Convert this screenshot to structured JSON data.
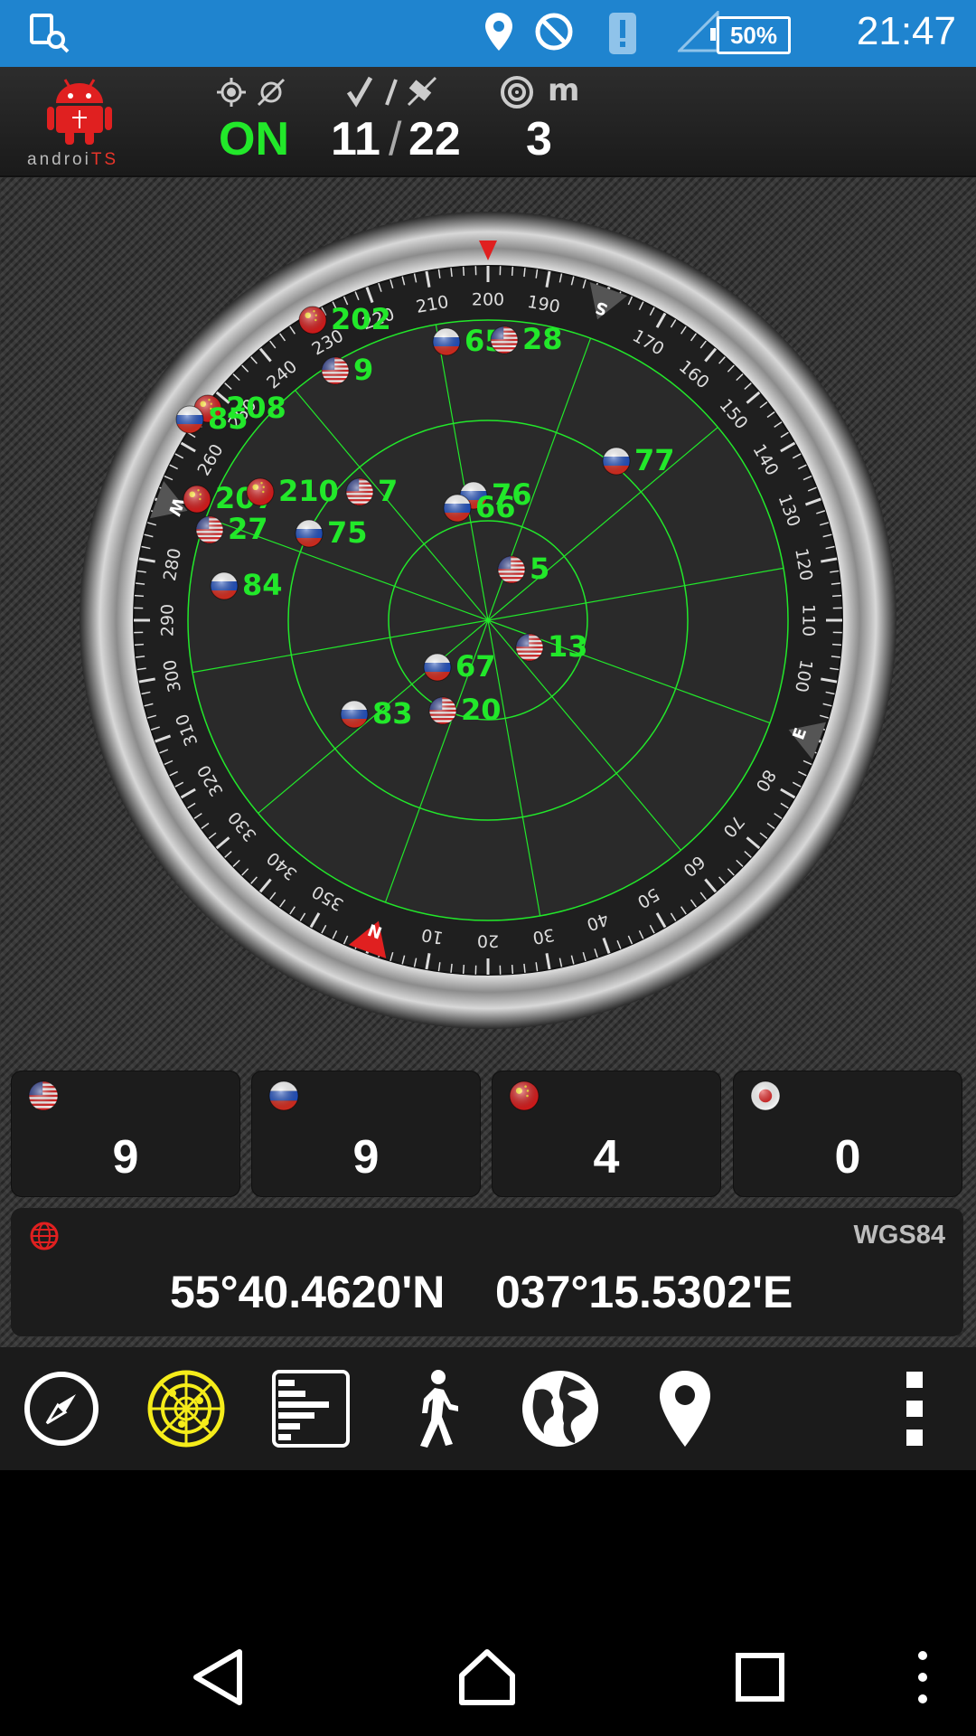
{
  "status_bar": {
    "time": "21:47",
    "battery": "50%",
    "icons": [
      "gps-search-icon",
      "location-pin-icon",
      "do-not-disturb-icon",
      "alert-icon",
      "signal-icon"
    ]
  },
  "header": {
    "logo": "androiTS",
    "fix_status": "ON",
    "used_satellites": "11",
    "visible_satellites": "22",
    "accuracy": "3",
    "accuracy_unit": "m",
    "status_color": "#22e82a"
  },
  "compass": {
    "tick_labels": [
      "10",
      "20",
      "30",
      "40",
      "50",
      "60",
      "70",
      "80",
      "100",
      "110",
      "120",
      "130",
      "140",
      "150",
      "160",
      "170",
      "190",
      "200",
      "210",
      "220",
      "230",
      "240",
      "250",
      "260",
      "280",
      "290",
      "300",
      "310",
      "320",
      "330",
      "340",
      "350"
    ],
    "cardinals": {
      "N": "N",
      "E": "E",
      "S": "S",
      "W": "W"
    }
  },
  "satellites": [
    {
      "id": "202",
      "flag": "china"
    },
    {
      "id": "65",
      "flag": "russia"
    },
    {
      "id": "28",
      "flag": "usa"
    },
    {
      "id": "9",
      "flag": "usa"
    },
    {
      "id": "208",
      "flag": "china"
    },
    {
      "id": "85",
      "flag": "russia"
    },
    {
      "id": "77",
      "flag": "russia"
    },
    {
      "id": "207",
      "flag": "china"
    },
    {
      "id": "210",
      "flag": "china"
    },
    {
      "id": "7",
      "flag": "usa"
    },
    {
      "id": "76",
      "flag": "russia"
    },
    {
      "id": "66",
      "flag": "russia"
    },
    {
      "id": "27",
      "flag": "usa"
    },
    {
      "id": "75",
      "flag": "russia"
    },
    {
      "id": "5",
      "flag": "usa"
    },
    {
      "id": "84",
      "flag": "russia"
    },
    {
      "id": "13",
      "flag": "usa"
    },
    {
      "id": "67",
      "flag": "russia"
    },
    {
      "id": "83",
      "flag": "russia"
    },
    {
      "id": "20",
      "flag": "usa"
    }
  ],
  "constellations": [
    {
      "name": "usa",
      "count": "9"
    },
    {
      "name": "russia",
      "count": "9"
    },
    {
      "name": "china",
      "count": "4"
    },
    {
      "name": "japan",
      "count": "0"
    }
  ],
  "position": {
    "datum": "WGS84",
    "latitude": "55°40.4620'N",
    "longitude": "037°15.5302'E"
  },
  "toolbar": [
    "compass-icon",
    "radar-icon",
    "signal-bars-icon",
    "walking-icon",
    "globe-icon",
    "map-pin-icon",
    "overflow-menu-icon"
  ],
  "colors": {
    "label_green": "#22e82a",
    "statusbar": "#1f84cf",
    "radar_yellow": "#f5ec1a"
  }
}
